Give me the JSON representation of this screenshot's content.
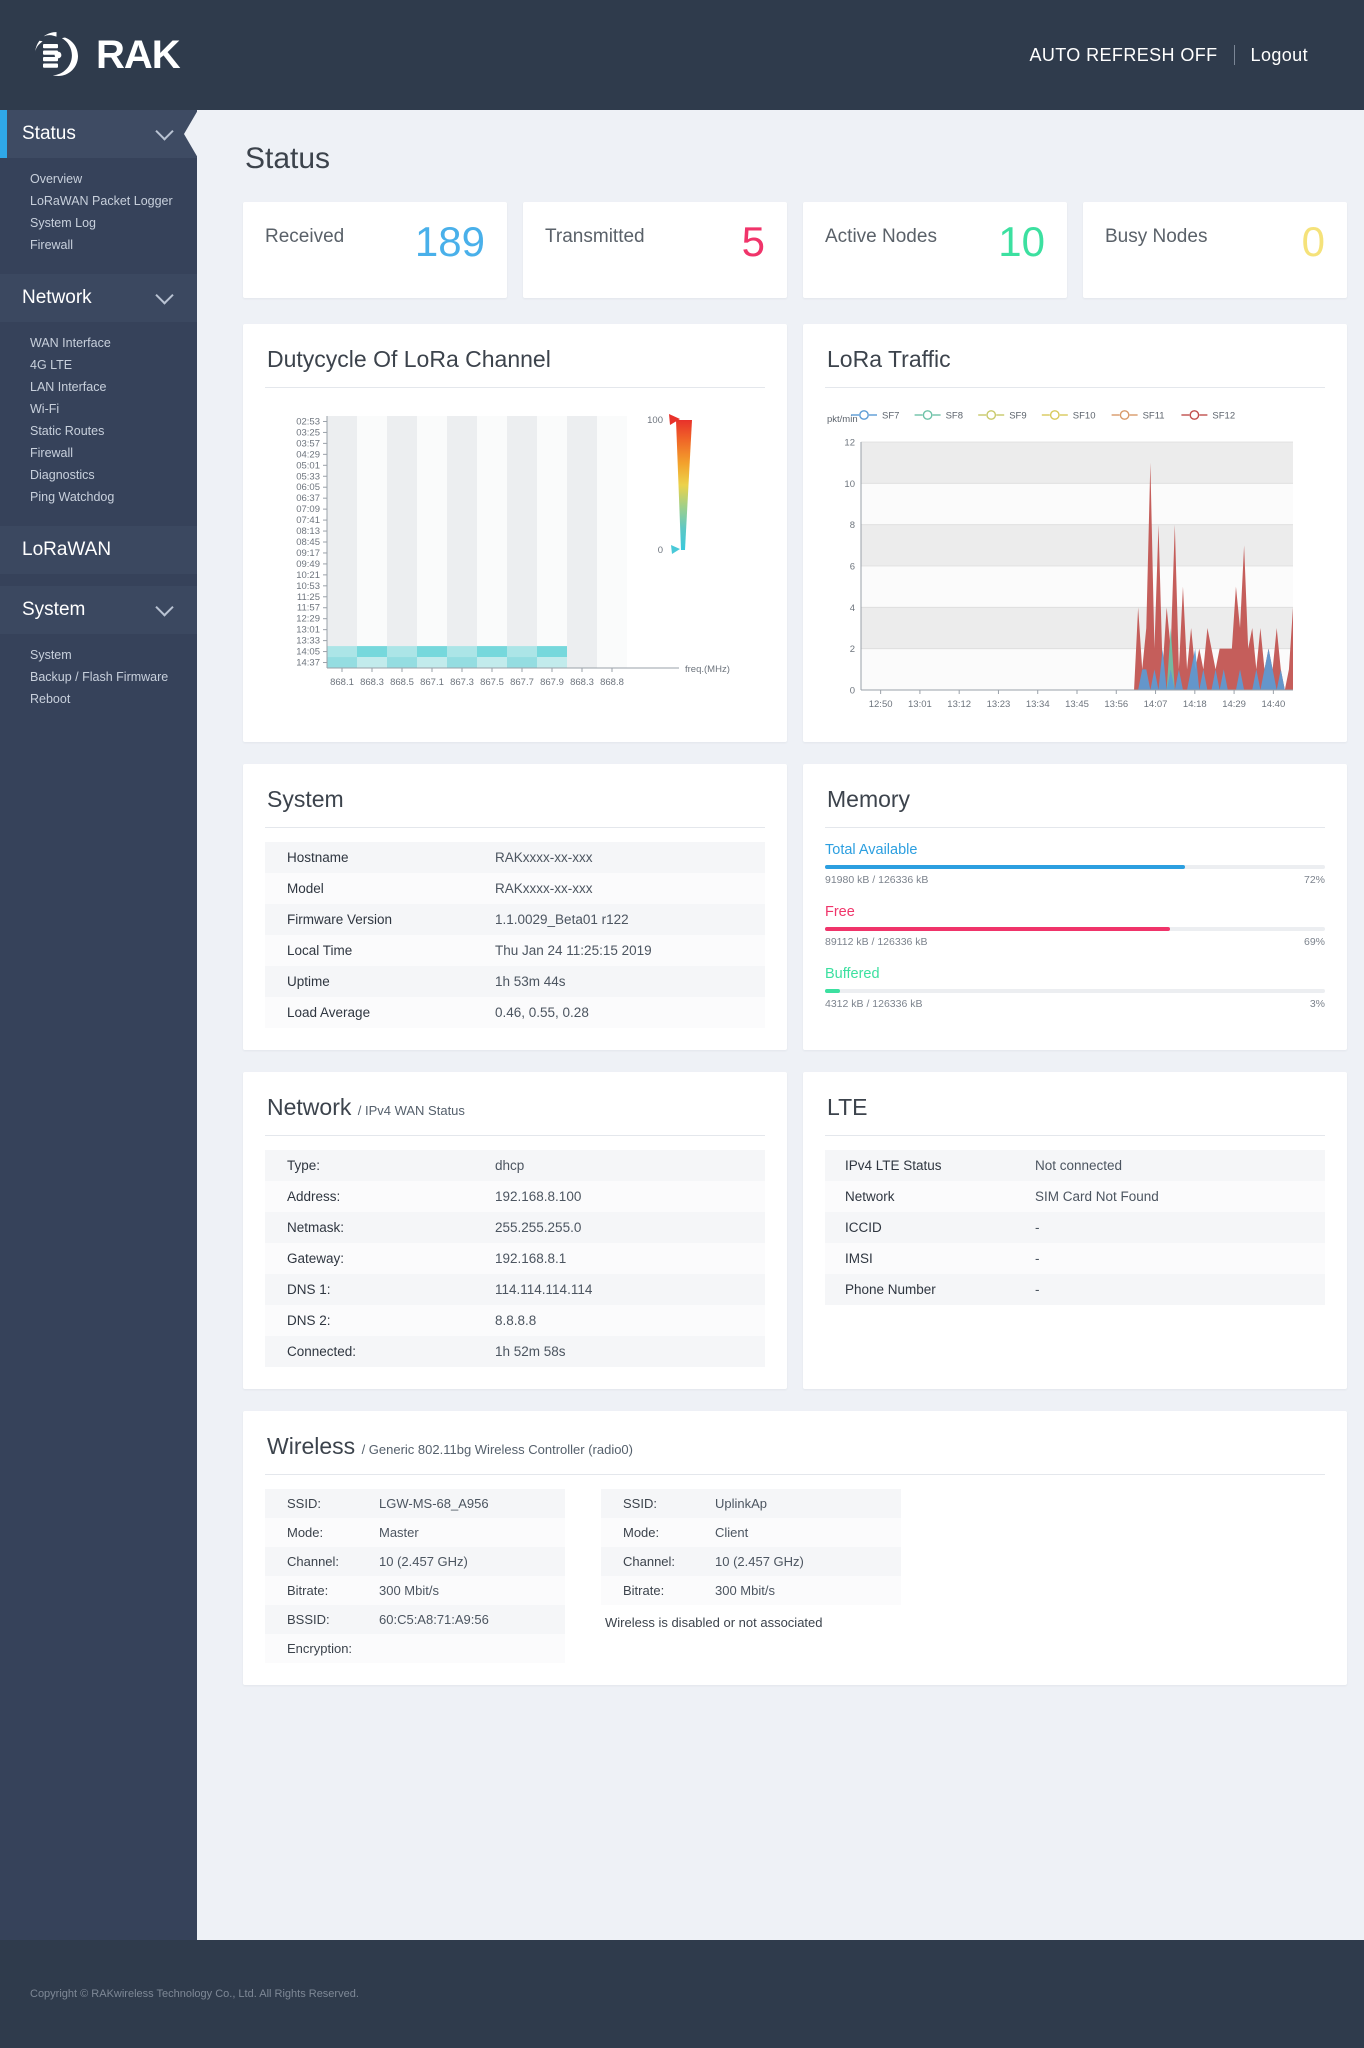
{
  "header": {
    "brand": "RAK",
    "logo_icon": "rak-logo-icon",
    "auto_refresh_label": "AUTO REFRESH OFF",
    "logout_label": "Logout"
  },
  "sidebar": {
    "groups": [
      {
        "label": "Status",
        "active": true,
        "expandable": true,
        "icon": "chevron-down-icon",
        "items": [
          "Overview",
          "LoRaWAN Packet Logger",
          "System Log",
          "Firewall"
        ]
      },
      {
        "label": "Network",
        "active": false,
        "expandable": true,
        "icon": "chevron-down-icon",
        "items": [
          "WAN Interface",
          "4G LTE",
          "LAN Interface",
          "Wi-Fi",
          "Static Routes",
          "Firewall",
          "Diagnostics",
          "Ping Watchdog"
        ]
      },
      {
        "label": "LoRaWAN",
        "active": false,
        "expandable": false,
        "items": []
      },
      {
        "label": "System",
        "active": false,
        "expandable": true,
        "icon": "chevron-down-icon",
        "items": [
          "System",
          "Backup / Flash Firmware",
          "Reboot"
        ]
      }
    ]
  },
  "page": {
    "title": "Status"
  },
  "stats": [
    {
      "label": "Received",
      "value": "189",
      "color": "#49b0ea"
    },
    {
      "label": "Transmitted",
      "value": "5",
      "color": "#f0346a"
    },
    {
      "label": "Active Nodes",
      "value": "10",
      "color": "#3ce0a0"
    },
    {
      "label": "Busy Nodes",
      "value": "0",
      "color": "#f5e27a"
    }
  ],
  "chart_data": [
    {
      "id": "dutycycle",
      "type": "heatmap",
      "title": "Dutycycle Of LoRa Channel",
      "xlabel": "freq.(MHz)",
      "ylabel": "",
      "x_ticks": [
        "868.1",
        "868.3",
        "868.5",
        "867.1",
        "867.3",
        "867.5",
        "867.7",
        "867.9",
        "868.3",
        "868.8"
      ],
      "y_ticks": [
        "02:53",
        "03:25",
        "03:57",
        "04:29",
        "05:01",
        "05:33",
        "06:05",
        "06:37",
        "07:09",
        "07:41",
        "08:13",
        "08:45",
        "09:17",
        "09:49",
        "10:21",
        "10:53",
        "11:25",
        "11:57",
        "12:29",
        "13:01",
        "13:33",
        "14:05",
        "14:37"
      ],
      "colorbar": {
        "max": "100",
        "min": "0",
        "stops": [
          "#e8312a",
          "#f06b28",
          "#f3a22c",
          "#ecd24a",
          "#9fd08a",
          "#5ec8c4",
          "#38c9dd"
        ]
      },
      "note": "Activity only in the last two time rows (14:05-14:37) across the first 8 frequency columns, rendered in light cyan.",
      "active_rows": [
        "14:05",
        "14:37"
      ],
      "active_columns": [
        "868.1",
        "868.3",
        "868.5",
        "867.1",
        "867.3",
        "867.5",
        "867.7",
        "867.9"
      ],
      "grid": true
    },
    {
      "id": "lora_traffic",
      "type": "area",
      "title": "LoRa Traffic",
      "ylabel": "pkt/min",
      "xlabel": "",
      "ylim": [
        0,
        12
      ],
      "y_ticks": [
        "0",
        "2",
        "4",
        "6",
        "8",
        "10",
        "12"
      ],
      "x_ticks": [
        "12:50",
        "13:01",
        "13:12",
        "13:23",
        "13:34",
        "13:45",
        "13:56",
        "14:07",
        "14:18",
        "14:29",
        "14:40"
      ],
      "legend": [
        {
          "name": "SF7",
          "color": "#5b9bd5"
        },
        {
          "name": "SF8",
          "color": "#6ec2a8"
        },
        {
          "name": "SF9",
          "color": "#c8c96a"
        },
        {
          "name": "SF10",
          "color": "#d8c95a"
        },
        {
          "name": "SF11",
          "color": "#d89a6a"
        },
        {
          "name": "SF12",
          "color": "#c0504d"
        }
      ],
      "legend_position": "top",
      "grid": true,
      "series": [
        {
          "name": "SF7",
          "color": "#5b9bd5",
          "values": [
            0,
            0,
            0,
            0,
            0,
            0,
            0,
            0,
            0,
            0,
            0,
            0,
            0,
            0,
            0,
            0,
            0,
            0,
            0,
            0,
            0,
            0,
            0,
            0,
            0,
            0,
            0,
            0,
            0,
            0,
            0,
            0,
            0,
            0,
            0,
            0,
            0,
            0,
            0,
            0,
            0,
            0,
            0,
            0,
            0,
            0,
            0,
            0,
            0,
            0,
            0,
            0,
            0,
            0,
            0,
            0,
            0,
            0,
            0,
            0,
            0,
            0,
            0,
            0,
            0,
            0,
            0,
            0,
            0,
            1,
            1,
            0,
            1,
            0,
            2,
            0,
            1,
            0,
            1,
            0,
            0,
            1,
            2,
            0,
            1,
            0,
            0,
            1,
            0,
            1,
            0,
            0,
            0,
            1,
            0,
            0,
            0,
            1,
            0,
            1,
            2,
            1,
            0,
            1,
            0,
            0,
            0
          ]
        },
        {
          "name": "SF8",
          "color": "#6ec2a8",
          "values": [
            0,
            0,
            0,
            0,
            0,
            0,
            0,
            0,
            0,
            0,
            0,
            0,
            0,
            0,
            0,
            0,
            0,
            0,
            0,
            0,
            0,
            0,
            0,
            0,
            0,
            0,
            0,
            0,
            0,
            0,
            0,
            0,
            0,
            0,
            0,
            0,
            0,
            0,
            0,
            0,
            0,
            0,
            0,
            0,
            0,
            0,
            0,
            0,
            0,
            0,
            0,
            0,
            0,
            0,
            0,
            0,
            0,
            0,
            0,
            0,
            0,
            0,
            0,
            0,
            0,
            0,
            0,
            0,
            0,
            0,
            0,
            0,
            0,
            0,
            0,
            0,
            3,
            0,
            0,
            0,
            0,
            0,
            0,
            0,
            0,
            0,
            0,
            0,
            0,
            0,
            0,
            0,
            0,
            0,
            0,
            0,
            0,
            0,
            0,
            0,
            0,
            0,
            0,
            0,
            0,
            0,
            0
          ]
        },
        {
          "name": "SF12",
          "color": "#c0504d",
          "values": [
            0,
            0,
            0,
            0,
            0,
            0,
            0,
            0,
            0,
            0,
            0,
            0,
            0,
            0,
            0,
            0,
            0,
            0,
            0,
            0,
            0,
            0,
            0,
            0,
            0,
            0,
            0,
            0,
            0,
            0,
            0,
            0,
            0,
            0,
            0,
            0,
            0,
            0,
            0,
            0,
            0,
            0,
            0,
            0,
            0,
            0,
            0,
            0,
            0,
            0,
            0,
            0,
            0,
            0,
            0,
            0,
            0,
            0,
            0,
            0,
            0,
            0,
            0,
            0,
            0,
            0,
            0,
            0,
            4,
            1,
            3,
            11,
            2,
            8,
            1,
            4,
            2,
            8,
            1,
            5,
            1,
            3,
            1,
            2,
            1,
            3,
            2,
            1,
            2,
            2,
            2,
            2,
            5,
            3,
            7,
            2,
            3,
            1,
            3,
            1,
            2,
            1,
            3,
            1,
            0,
            1,
            4
          ]
        }
      ]
    }
  ],
  "system": {
    "title": "System",
    "rows": [
      {
        "key": "Hostname",
        "value": "RAKxxxx-xx-xxx"
      },
      {
        "key": "Model",
        "value": "RAKxxxx-xx-xxx"
      },
      {
        "key": "Firmware Version",
        "value": "1.1.0029_Beta01 r122"
      },
      {
        "key": "Local Time",
        "value": "Thu Jan 24 11:25:15 2019"
      },
      {
        "key": "Uptime",
        "value": "1h 53m 44s"
      },
      {
        "key": "Load Average",
        "value": "0.46, 0.55, 0.28"
      }
    ]
  },
  "memory": {
    "title": "Memory",
    "bars": [
      {
        "label": "Total Available",
        "detail": "91980 kB / 126336 kB",
        "percent": "72%",
        "value": 72,
        "color": "#2c9fe0"
      },
      {
        "label": "Free",
        "detail": "89112 kB / 126336 kB",
        "percent": "69%",
        "value": 69,
        "color": "#f0346a"
      },
      {
        "label": "Buffered",
        "detail": "4312 kB / 126336 kB",
        "percent": "3%",
        "value": 3,
        "color": "#3ce0a0"
      }
    ]
  },
  "network": {
    "title": "Network",
    "subtitle": "/ IPv4 WAN Status",
    "rows": [
      {
        "key": "Type:",
        "value": "dhcp"
      },
      {
        "key": "Address:",
        "value": "192.168.8.100"
      },
      {
        "key": "Netmask:",
        "value": "255.255.255.0"
      },
      {
        "key": "Gateway:",
        "value": "192.168.8.1"
      },
      {
        "key": "DNS 1:",
        "value": "114.114.114.114"
      },
      {
        "key": "DNS 2:",
        "value": "8.8.8.8"
      },
      {
        "key": "Connected:",
        "value": "1h 52m 58s"
      }
    ]
  },
  "lte": {
    "title": "LTE",
    "rows": [
      {
        "key": "IPv4 LTE Status",
        "value": "Not connected"
      },
      {
        "key": "Network",
        "value": "SIM Card Not Found"
      },
      {
        "key": "ICCID",
        "value": "-"
      },
      {
        "key": "IMSI",
        "value": "-"
      },
      {
        "key": "Phone Number",
        "value": "-"
      }
    ]
  },
  "wireless": {
    "title": "Wireless",
    "subtitle": "/ Generic 802.11bg Wireless Controller (radio0)",
    "left": [
      {
        "key": "SSID:",
        "value": "LGW-MS-68_A956",
        "link": true
      },
      {
        "key": "Mode:",
        "value": "Master"
      },
      {
        "key": "Channel:",
        "value": "10 (2.457 GHz)"
      },
      {
        "key": "Bitrate:",
        "value": "300 Mbit/s"
      },
      {
        "key": "BSSID:",
        "value": "60:C5:A8:71:A9:56"
      },
      {
        "key": "Encryption:",
        "value": "-"
      }
    ],
    "right": [
      {
        "key": "SSID:",
        "value": "UplinkAp"
      },
      {
        "key": "Mode:",
        "value": "Client"
      },
      {
        "key": "Channel:",
        "value": "10 (2.457 GHz)"
      },
      {
        "key": "Bitrate:",
        "value": "300 Mbit/s"
      }
    ],
    "right_note": "Wireless is disabled or not associated"
  },
  "footer": {
    "copyright": "Copyright © RAKwireless Technology Co., Ltd. All Rights Reserved."
  }
}
